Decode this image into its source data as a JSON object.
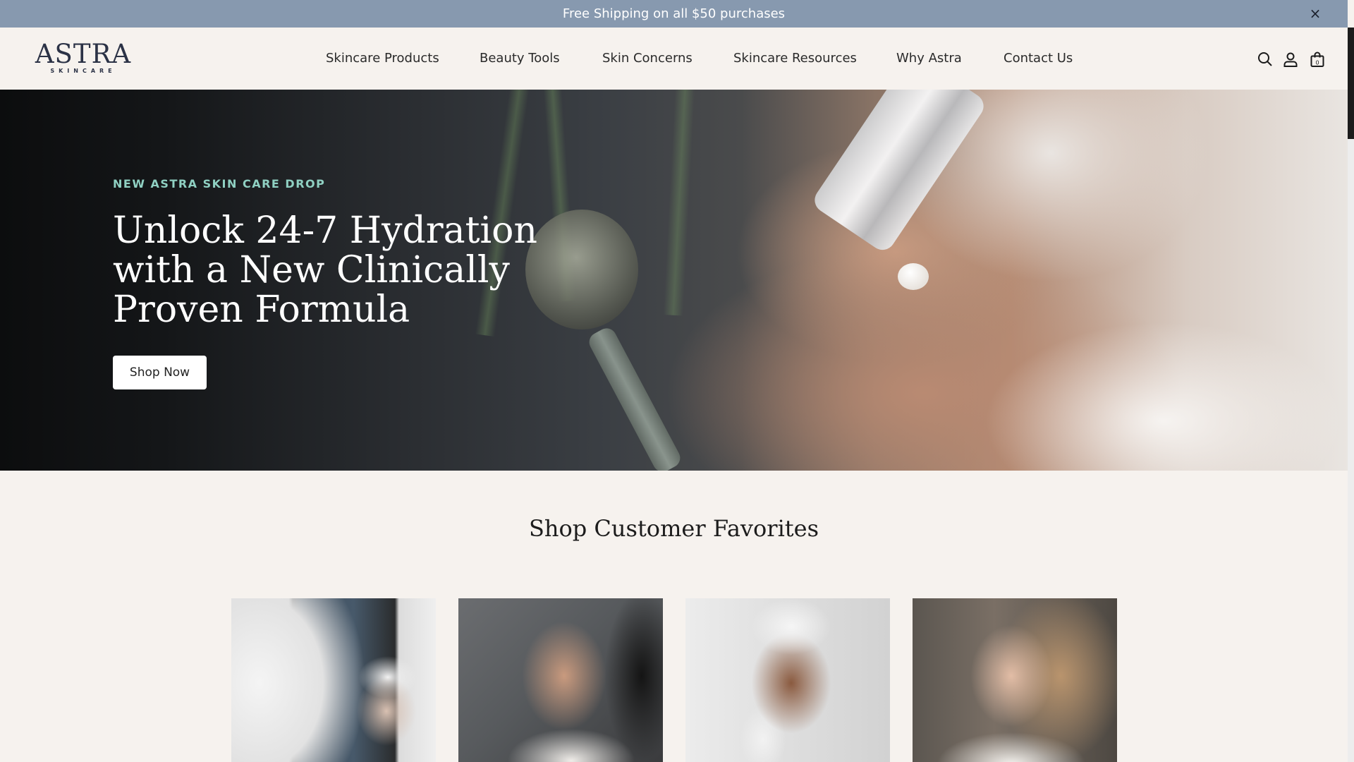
{
  "announcement": {
    "text": "Free Shipping on all $50 purchases",
    "close_glyph": "×"
  },
  "logo": {
    "main": "ASTRA",
    "sub": "SKINCARE"
  },
  "nav": {
    "items": [
      {
        "label": "Skincare Products"
      },
      {
        "label": "Beauty Tools"
      },
      {
        "label": "Skin Concerns"
      },
      {
        "label": "Skincare Resources"
      },
      {
        "label": "Why Astra"
      },
      {
        "label": "Contact Us"
      }
    ]
  },
  "header_icons": {
    "search": "search-icon",
    "account": "user-icon",
    "cart": "bag-icon",
    "cart_count": "0"
  },
  "hero": {
    "eyebrow": "NEW ASTRA SKIN CARE DROP",
    "title": "Unlock 24-7 Hydration with a New Clinically Proven Formula",
    "cta_label": "Shop Now"
  },
  "favorites": {
    "title": "Shop Customer Favorites"
  },
  "colors": {
    "announcement_bg": "#8799af",
    "page_bg": "#f6f2ee",
    "eyebrow": "#8fd0c2",
    "logo": "#2b3246"
  }
}
